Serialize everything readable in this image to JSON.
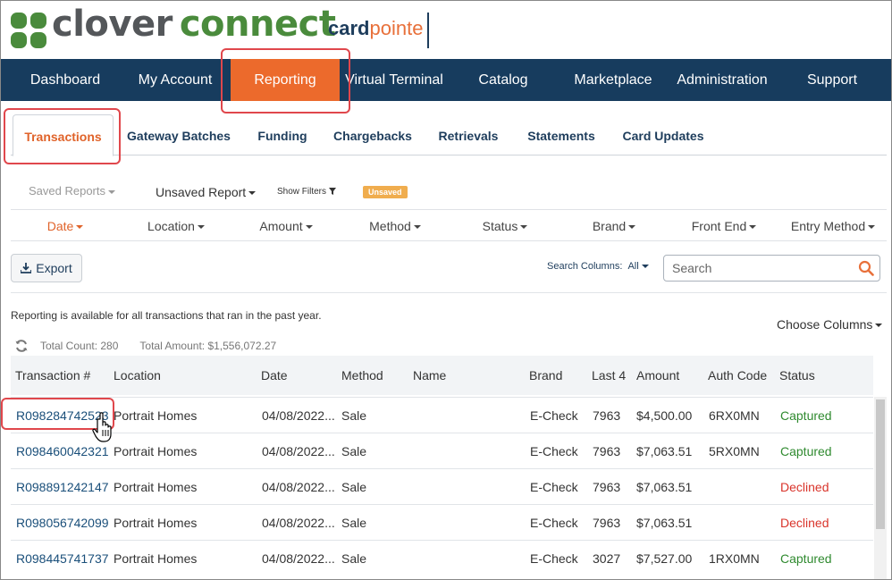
{
  "header": {
    "brand_word1": "clover",
    "brand_word2": "connect",
    "sub_brand_part1": "card",
    "sub_brand_part2": "pointe"
  },
  "colors": {
    "nav_bg": "#173c5e",
    "accent_orange": "#ec6a2c",
    "highlight_red": "#e0474c",
    "captured_green": "#2f8a2f",
    "declined_red": "#d9342b",
    "link_blue": "#1a4f7a"
  },
  "main_nav": {
    "items": [
      {
        "label": "Dashboard"
      },
      {
        "label": "My Account"
      },
      {
        "label": "Reporting"
      },
      {
        "label": "Virtual Terminal"
      },
      {
        "label": "Catalog"
      },
      {
        "label": "Marketplace"
      },
      {
        "label": "Administration"
      },
      {
        "label": "Support"
      }
    ],
    "active": "Reporting"
  },
  "sub_tabs": {
    "items": [
      {
        "label": "Transactions"
      },
      {
        "label": "Gateway Batches"
      },
      {
        "label": "Funding"
      },
      {
        "label": "Chargebacks"
      },
      {
        "label": "Retrievals"
      },
      {
        "label": "Statements"
      },
      {
        "label": "Card Updates"
      }
    ],
    "active": "Transactions"
  },
  "report_bar": {
    "saved_reports": "Saved Reports",
    "unsaved_report": "Unsaved Report",
    "show_filters": "Show Filters",
    "unsaved_badge": "Unsaved"
  },
  "filters": {
    "items": [
      {
        "label": "Date"
      },
      {
        "label": "Location"
      },
      {
        "label": "Amount"
      },
      {
        "label": "Method"
      },
      {
        "label": "Status"
      },
      {
        "label": "Brand"
      },
      {
        "label": "Front End"
      },
      {
        "label": "Entry Method"
      }
    ],
    "active": "Date"
  },
  "toolbar": {
    "export_label": "Export",
    "search_columns_label": "Search Columns:",
    "search_columns_value": "All",
    "search_placeholder": "Search",
    "search_value": ""
  },
  "info": {
    "message": "Reporting is available for all transactions that ran in the past year.",
    "choose_columns": "Choose Columns",
    "total_count": "Total Count: 280",
    "total_amount": "Total Amount: $1,556,072.27"
  },
  "table": {
    "columns": [
      "Transaction #",
      "Location",
      "Date",
      "Method",
      "Name",
      "Brand",
      "Last 4",
      "Amount",
      "Auth Code",
      "Status"
    ],
    "rows": [
      {
        "txn": "R098284742523",
        "location": "Portrait Homes",
        "date": "04/08/2022...",
        "method": "Sale",
        "name": "",
        "brand": "E-Check",
        "last4": "7963",
        "amount": "$4,500.00",
        "auth": "6RX0MN",
        "status": "Captured"
      },
      {
        "txn": "R098460042321",
        "location": "Portrait Homes",
        "date": "04/08/2022...",
        "method": "Sale",
        "name": "",
        "brand": "E-Check",
        "last4": "7963",
        "amount": "$7,063.51",
        "auth": "5RX0MN",
        "status": "Captured"
      },
      {
        "txn": "R098891242147",
        "location": "Portrait Homes",
        "date": "04/08/2022...",
        "method": "Sale",
        "name": "",
        "brand": "E-Check",
        "last4": "7963",
        "amount": "$7,063.51",
        "auth": "",
        "status": "Declined"
      },
      {
        "txn": "R098056742099",
        "location": "Portrait Homes",
        "date": "04/08/2022...",
        "method": "Sale",
        "name": "",
        "brand": "E-Check",
        "last4": "7963",
        "amount": "$7,063.51",
        "auth": "",
        "status": "Declined"
      },
      {
        "txn": "R098445741737",
        "location": "Portrait Homes",
        "date": "04/08/2022...",
        "method": "Sale",
        "name": "",
        "brand": "E-Check",
        "last4": "3027",
        "amount": "$7,527.00",
        "auth": "1RX0MN",
        "status": "Captured"
      }
    ]
  },
  "icons": {
    "logo": "clover-leaf-logo",
    "export": "download-icon",
    "search": "search-icon",
    "refresh": "refresh-icon",
    "cursor": "hand-pointer-icon"
  }
}
